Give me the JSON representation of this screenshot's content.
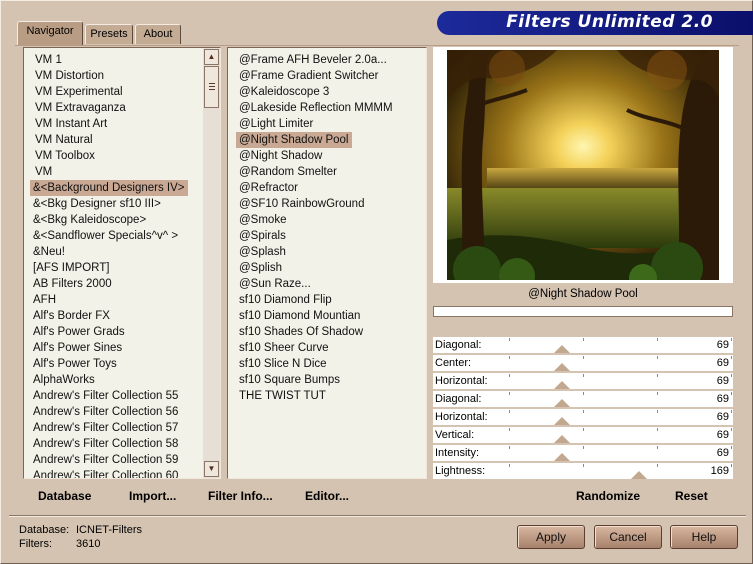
{
  "app": {
    "title": "Filters Unlimited 2.0"
  },
  "tabs": [
    {
      "label": "Navigator",
      "active": true
    },
    {
      "label": "Presets",
      "active": false
    },
    {
      "label": "About",
      "active": false
    }
  ],
  "categories": [
    "VM 1",
    "VM Distortion",
    "VM Experimental",
    "VM Extravaganza",
    "VM Instant Art",
    "VM Natural",
    "VM Toolbox",
    "VM",
    "&<Background Designers IV>",
    "&<Bkg Designer sf10 III>",
    "&<Bkg Kaleidoscope>",
    "&<Sandflower Specials^v^ >",
    "&Neu!",
    "[AFS IMPORT]",
    "AB Filters 2000",
    "AFH",
    "Alf's Border FX",
    "Alf's Power Grads",
    "Alf's Power Sines",
    "Alf's Power Toys",
    "AlphaWorks",
    "Andrew's Filter Collection 55",
    "Andrew's Filter Collection 56",
    "Andrew's Filter Collection 57",
    "Andrew's Filter Collection 58",
    "Andrew's Filter Collection 59",
    "Andrew's Filter Collection 60"
  ],
  "categories_selected": 8,
  "filters": [
    "@Frame AFH Beveler 2.0a...",
    "@Frame Gradient Switcher",
    "@Kaleidoscope 3",
    "@Lakeside Reflection MMMM",
    "@Light Limiter",
    "@Night Shadow Pool",
    "@Night Shadow",
    "@Random Smelter",
    "@Refractor",
    "@SF10 RainbowGround",
    "@Smoke",
    "@Spirals",
    "@Splash",
    "@Splish",
    "@Sun Raze...",
    "sf10 Diamond Flip",
    "sf10 Diamond Mountian",
    "sf10 Shades Of Shadow",
    "sf10 Sheer Curve",
    "sf10 Slice N Dice",
    "sf10 Square Bumps",
    "THE TWIST TUT"
  ],
  "filters_selected": 5,
  "preview": {
    "filter_name": "@Night Shadow Pool",
    "progress": 0
  },
  "sliders": [
    {
      "label": "Diagonal:",
      "value": "69"
    },
    {
      "label": "Center:",
      "value": "69"
    },
    {
      "label": "Horizontal:",
      "value": "69"
    },
    {
      "label": "Diagonal:",
      "value": "69"
    },
    {
      "label": "Horizontal:",
      "value": "69"
    },
    {
      "label": "Vertical:",
      "value": "69"
    },
    {
      "label": "Intensity:",
      "value": "69"
    },
    {
      "label": "Lightness:",
      "value": "169"
    }
  ],
  "toolbar": {
    "database": "Database",
    "import": "Import...",
    "filter_info": "Filter Info...",
    "editor": "Editor...",
    "randomize": "Randomize",
    "reset": "Reset"
  },
  "status": {
    "database_label": "Database:",
    "database_value": "ICNET-Filters",
    "filters_label": "Filters:",
    "filters_value": "3610"
  },
  "buttons": {
    "apply": "Apply",
    "cancel": "Cancel",
    "help": "Help"
  },
  "colors": {
    "banner": "#0b0f6b",
    "selection": "#c9a994",
    "background": "#d4c3b1"
  }
}
